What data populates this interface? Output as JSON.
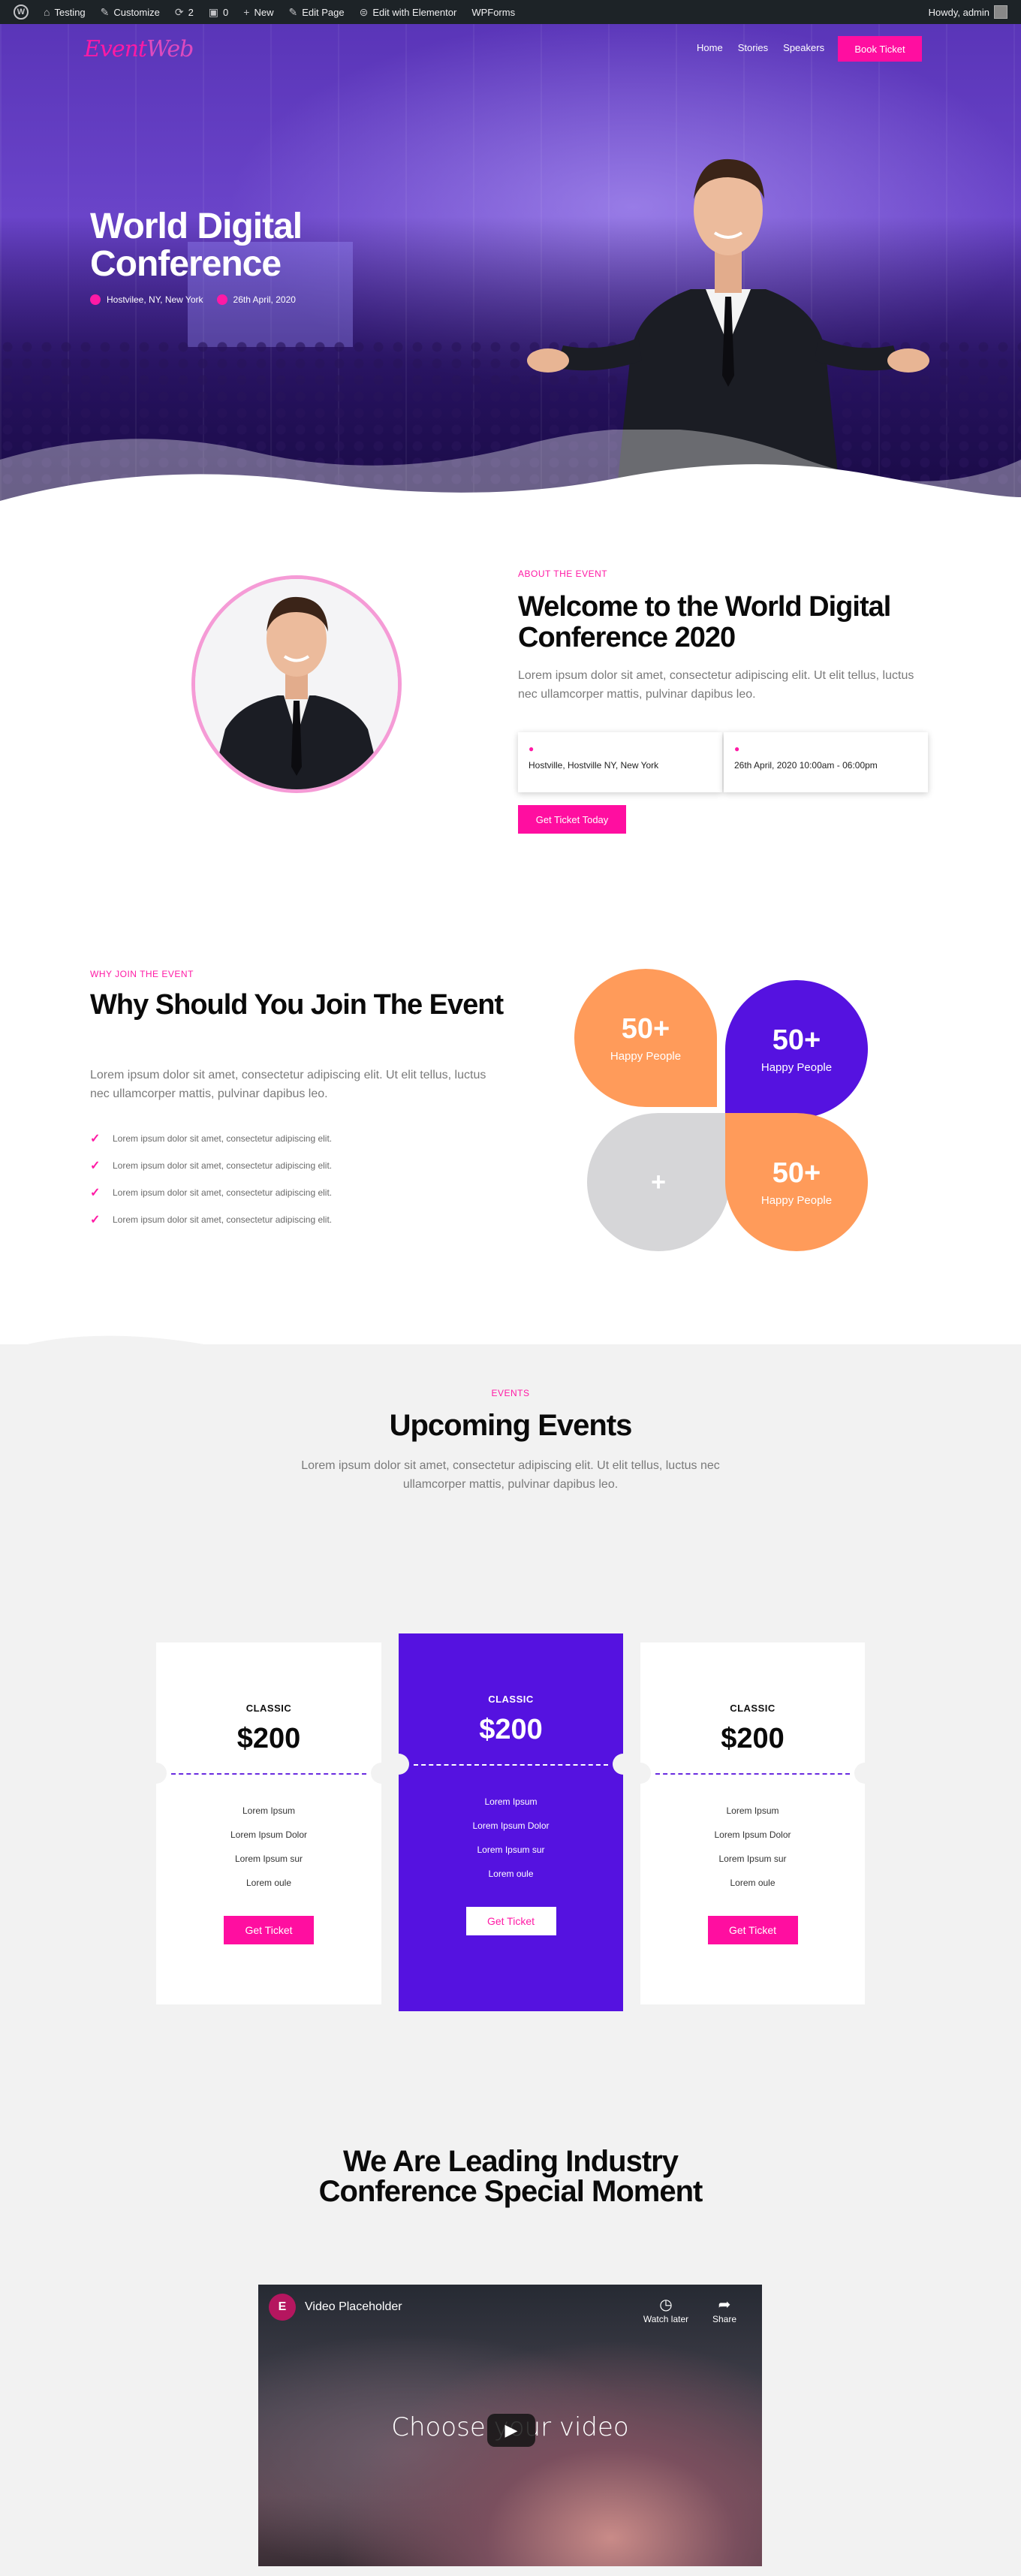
{
  "adminbar": {
    "site": "Testing",
    "customize": "Customize",
    "updates": "2",
    "comments": "0",
    "new": "New",
    "edit_page": "Edit Page",
    "edit_elementor": "Edit with Elementor",
    "wpforms": "WPForms",
    "howdy": "Howdy, admin"
  },
  "nav": {
    "logo_main": "Event",
    "logo_accent": "Web",
    "links": [
      "Home",
      "Stories",
      "Speakers"
    ],
    "book_label": "Book Ticket"
  },
  "hero": {
    "title": "World Digital Conference",
    "location": "Hostvilee, NY, New York",
    "date": "26th April, 2020"
  },
  "about": {
    "eyebrow": "ABOUT THE EVENT",
    "title": "Welcome to the World Digital Conference 2020",
    "text": "Lorem ipsum dolor sit amet, consectetur adipiscing elit. Ut elit tellus, luctus nec ullamcorper mattis, pulvinar dapibus leo.",
    "card_location": "Hostville, Hostville NY, New York",
    "card_date": "26th April, 2020 10:00am - 06:00pm",
    "button": "Get Ticket Today"
  },
  "why": {
    "eyebrow": "WHY JOIN THE EVENT",
    "title": "Why Should You Join The Event",
    "text": "Lorem ipsum dolor sit amet, consectetur adipiscing elit. Ut elit tellus, luctus nec ullamcorper mattis, pulvinar dapibus leo.",
    "items": [
      "Lorem ipsum dolor sit amet, consectetur adipiscing elit.",
      "Lorem ipsum dolor sit amet, consectetur adipiscing elit.",
      "Lorem ipsum dolor sit amet, consectetur adipiscing elit.",
      "Lorem ipsum dolor sit amet, consectetur adipiscing elit."
    ],
    "stats": [
      {
        "num": "50+",
        "label": "Happy People"
      },
      {
        "num": "50+",
        "label": "Happy People"
      },
      {
        "num": "+",
        "label": ""
      },
      {
        "num": "50+",
        "label": "Happy People"
      }
    ]
  },
  "events": {
    "eyebrow": "EVENTS",
    "title": "Upcoming Events",
    "text": "Lorem ipsum dolor sit amet, consectetur adipiscing elit. Ut elit tellus, luctus nec ullamcorper mattis, pulvinar dapibus leo."
  },
  "pricing": [
    {
      "tier": "CLASSIC",
      "price": "$200",
      "features": [
        "Lorem Ipsum",
        "Lorem Ipsum Dolor",
        "Lorem Ipsum sur",
        "Lorem oule"
      ],
      "button": "Get Ticket"
    },
    {
      "tier": "CLASSIC",
      "price": "$200",
      "features": [
        "Lorem Ipsum",
        "Lorem Ipsum Dolor",
        "Lorem Ipsum sur",
        "Lorem oule"
      ],
      "button": "Get Ticket"
    },
    {
      "tier": "CLASSIC",
      "price": "$200",
      "features": [
        "Lorem Ipsum",
        "Lorem Ipsum Dolor",
        "Lorem Ipsum sur",
        "Lorem oule"
      ],
      "button": "Get Ticket"
    }
  ],
  "moment": {
    "title": "We Are Leading Industry Conference Special Moment"
  },
  "video": {
    "title": "Video Placeholder",
    "watch_later": "Watch later",
    "share": "Share",
    "caption": "Choose your video"
  },
  "colors": {
    "pink": "#ff0ea0",
    "purple": "#5512e0",
    "orange": "#ff9b5a",
    "grey": "#d6d6d8"
  }
}
